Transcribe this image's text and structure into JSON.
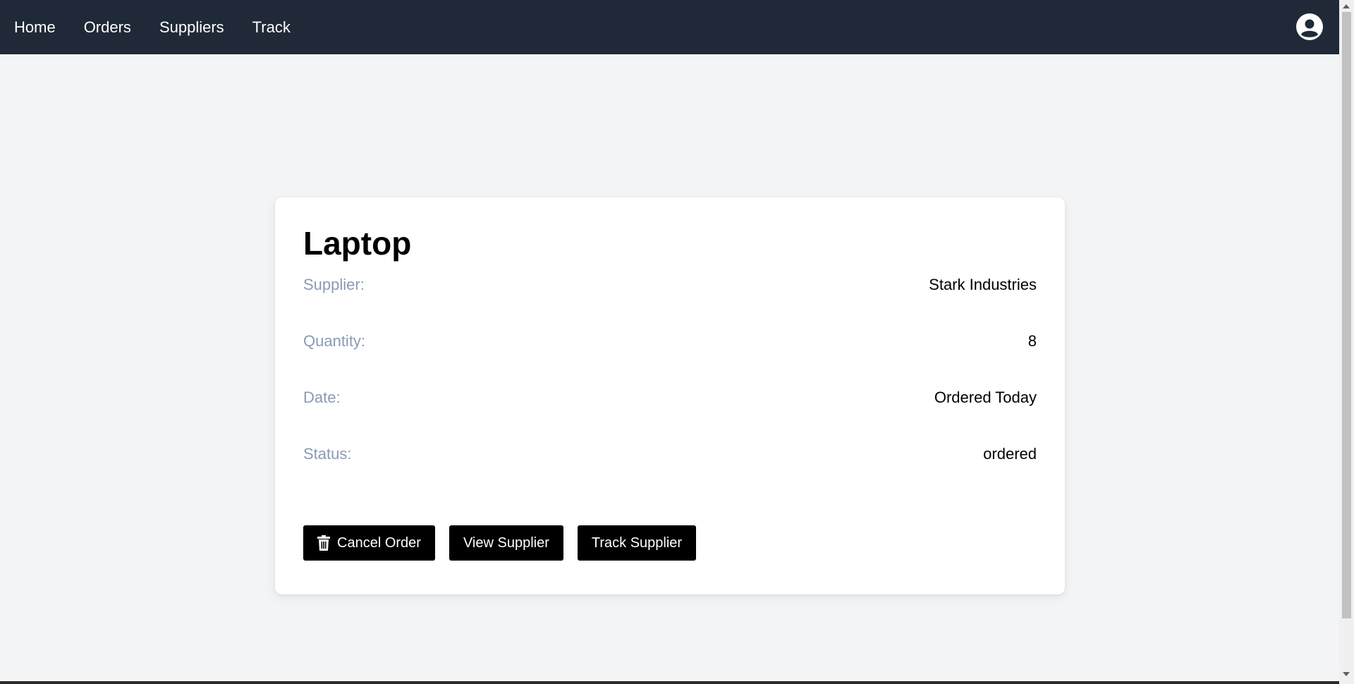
{
  "nav": {
    "links": [
      "Home",
      "Orders",
      "Suppliers",
      "Track"
    ],
    "profile_icon": "user-circle-icon"
  },
  "order": {
    "title": "Laptop",
    "details": [
      {
        "label": "Supplier:",
        "value": "Stark Industries"
      },
      {
        "label": "Quantity:",
        "value": "8"
      },
      {
        "label": "Date:",
        "value": "Ordered Today"
      },
      {
        "label": "Status:",
        "value": "ordered"
      }
    ]
  },
  "actions": {
    "cancel_label": "Cancel Order",
    "cancel_icon": "trash-icon",
    "view_supplier_label": "View Supplier",
    "track_supplier_label": "Track Supplier"
  },
  "colors": {
    "navbar": "#1f2937",
    "page_bg": "#f3f4f6",
    "label": "#8a9ab3",
    "button": "#000000"
  }
}
